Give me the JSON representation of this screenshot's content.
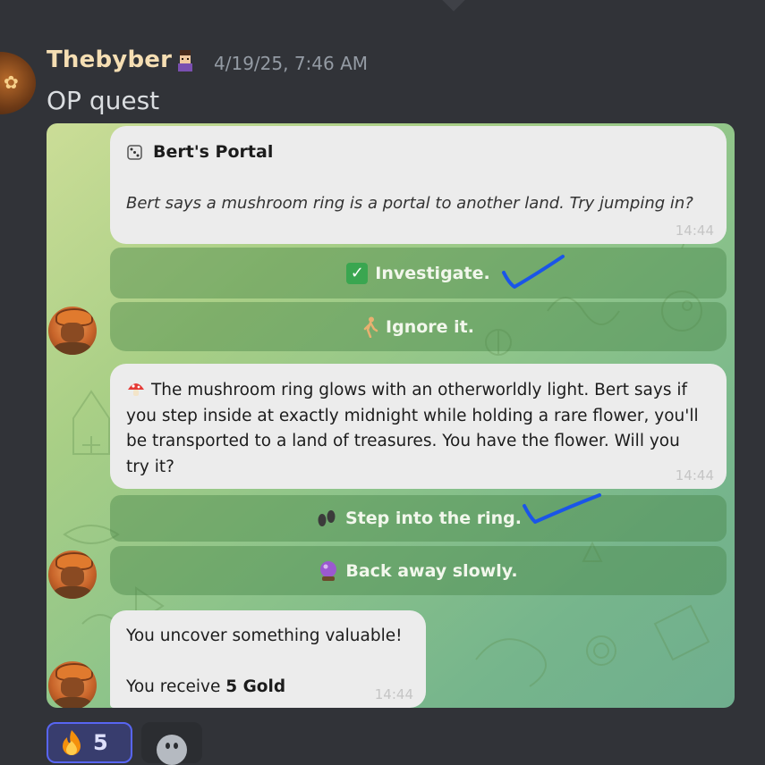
{
  "message": {
    "username": "Thebyber",
    "timestamp": "4/19/25, 7:46 AM",
    "text": "OP quest"
  },
  "bot_messages": [
    {
      "title": "Bert's Portal",
      "title_icon": "dice-icon",
      "body": "Bert says a mushroom ring is a portal to another land. Try jumping in?",
      "time": "14:44",
      "buttons": [
        {
          "icon": "check-box-icon",
          "label": "Investigate."
        },
        {
          "icon": "walking-person-icon",
          "label": "Ignore it."
        }
      ]
    },
    {
      "icon": "mushroom-icon",
      "body": "The mushroom ring glows with an otherworldly light. Bert says if you step inside at exactly midnight while holding a rare flower, you'll be transported to a land of treasures. You have the flower. Will you try it?",
      "time": "14:44",
      "buttons": [
        {
          "icon": "footprints-icon",
          "label": "Step into the ring."
        },
        {
          "icon": "crystal-ball-icon",
          "label": "Back away slowly."
        }
      ]
    },
    {
      "line1": "You uncover something valuable!",
      "line2_prefix": "You receive ",
      "line2_bold": "5 Gold",
      "time": "14:44"
    }
  ],
  "reactions": [
    {
      "icon": "fire-emoji-icon",
      "count": "5",
      "selected": true
    }
  ],
  "colors": {
    "background": "#313338",
    "username": "#f5deb3",
    "annotation_check": "#1a55e8",
    "reaction_border": "#5865f2"
  }
}
